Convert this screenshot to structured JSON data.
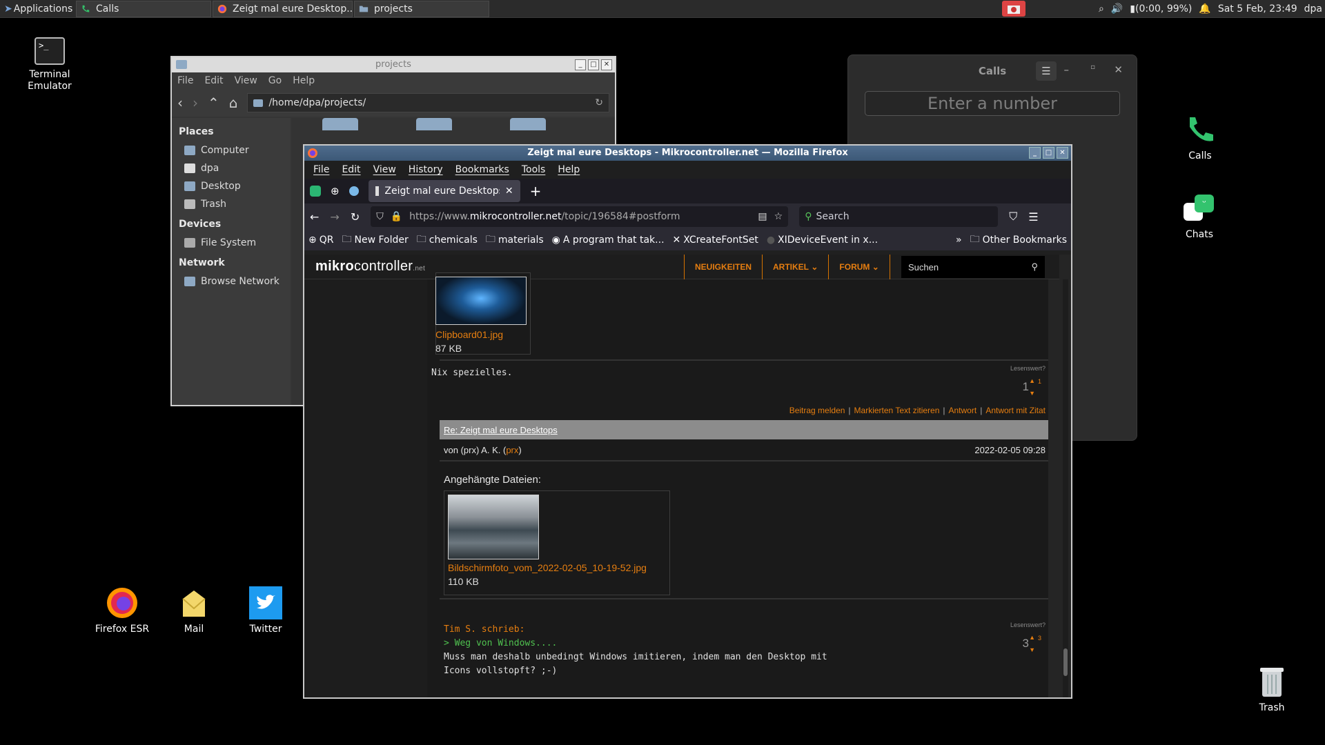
{
  "panel": {
    "apps_label": "Applications",
    "tasks": [
      {
        "label": "Calls"
      },
      {
        "label": "Zeigt mal eure Desktop..."
      },
      {
        "label": "projects"
      }
    ],
    "battery": "(0:00, 99%)",
    "datetime": "Sat  5 Feb, 23:49",
    "user": "dpa"
  },
  "desktop": {
    "terminal": "Terminal Emulator",
    "firefox": "Firefox ESR",
    "mail": "Mail",
    "twitter": "Twitter",
    "calls": "Calls",
    "chats": "Chats",
    "trash": "Trash"
  },
  "file_manager": {
    "title": "projects",
    "menu": [
      "File",
      "Edit",
      "View",
      "Go",
      "Help"
    ],
    "path": "/home/dpa/projects/",
    "places_title": "Places",
    "places": [
      "Computer",
      "dpa",
      "Desktop",
      "Trash"
    ],
    "devices_title": "Devices",
    "devices": [
      "File System"
    ],
    "network_title": "Network",
    "network": [
      "Browse Network"
    ]
  },
  "calls": {
    "title": "Calls",
    "number_placeholder": "Enter a number"
  },
  "firefox": {
    "title": "Zeigt mal eure Desktops - Mikrocontroller.net — Mozilla Firefox",
    "menu": [
      "File",
      "Edit",
      "View",
      "History",
      "Bookmarks",
      "Tools",
      "Help"
    ],
    "tab_label": "Zeigt mal eure Desktops",
    "url_prefix": "https://www.",
    "url_host": "mikrocontroller.net",
    "url_path": "/topic/196584#postform",
    "search_placeholder": "Search",
    "bookmarks": [
      "QR",
      "New Folder",
      "chemicals",
      "materials",
      "A program that tak...",
      "XCreateFontSet",
      "XIDeviceEvent in x..."
    ],
    "other_bookmarks": "Other Bookmarks"
  },
  "site": {
    "logo_main": "mikro",
    "logo_rest": "controller",
    "logo_tld": ".net",
    "nav": [
      "NEUIGKEITEN",
      "ARTIKEL",
      "FORUM"
    ],
    "search_placeholder": "Suchen",
    "post1": {
      "file_name": "Clipboard01.jpg",
      "file_size": "87 KB",
      "text": "Nix spezielles.",
      "rating_label": "Lesenswert?",
      "score": "1",
      "up_count": "1",
      "actions": [
        "Beitrag melden",
        "Markierten Text zitieren",
        "Antwort",
        "Antwort mit Zitat"
      ]
    },
    "post2": {
      "title": "Re: Zeigt mal eure Desktops",
      "author_prefix": "von (prx) A. K. (",
      "author_handle": "prx",
      "author_suffix": ")",
      "date": "2022-02-05 09:28",
      "attachments_label": "Angehängte Dateien:",
      "file_name": "Bildschirmfoto_vom_2022-02-05_10-19-52.jpg",
      "file_size": "110 KB",
      "rating_label": "Lesenswert?",
      "score": "3",
      "up_count": "3",
      "quote_author": "Tim S. schrieb:",
      "quote_text": "> Weg von Windows....",
      "line1": "Muss man deshalb unbedingt Windows imitieren, indem man den Desktop mit",
      "line2": "Icons vollstopft? ;-)"
    }
  }
}
